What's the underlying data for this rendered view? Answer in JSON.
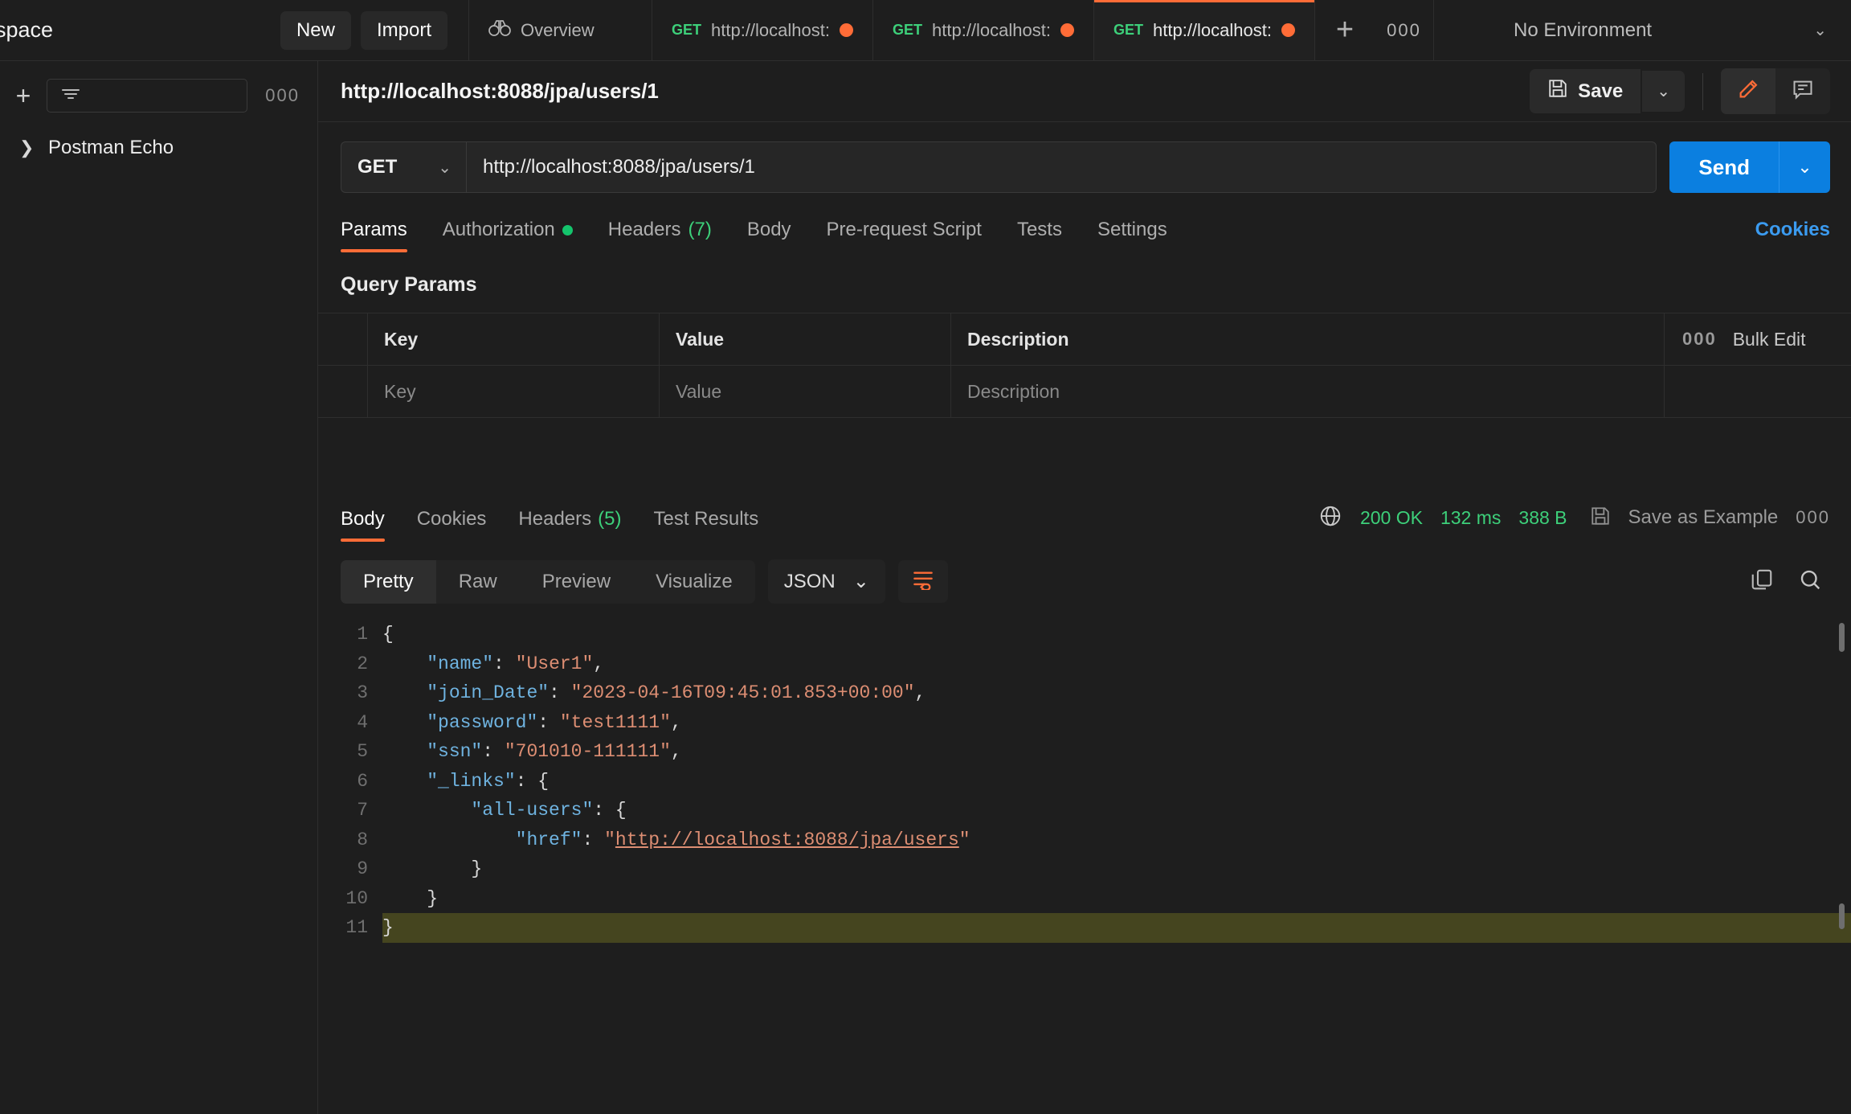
{
  "workspace": {
    "title": "space",
    "new_button": "New",
    "import_button": "Import"
  },
  "tabs": [
    {
      "label": "Overview",
      "icon": "binoculars-icon",
      "method": "",
      "active": false,
      "unsaved": false
    },
    {
      "label": "http://localhost:",
      "method": "GET",
      "active": false,
      "unsaved": true
    },
    {
      "label": "http://localhost:",
      "method": "GET",
      "active": false,
      "unsaved": true
    },
    {
      "label": "http://localhost:",
      "method": "GET",
      "active": true,
      "unsaved": true
    }
  ],
  "tab_actions": {
    "new_tab": "+",
    "more": "000"
  },
  "environment": {
    "selected": "No Environment",
    "caret": "chevron-down-icon"
  },
  "sidebar": {
    "add_icon": "+",
    "filter_icon": "filter-icon",
    "more_icon": "000",
    "items": [
      {
        "label": "Postman Echo",
        "caret": "chevron-right-icon"
      }
    ]
  },
  "request": {
    "title": "http://localhost:8088/jpa/users/1",
    "save_label": "Save",
    "save_icon": "floppy-icon",
    "save_caret": "chevron-down-icon",
    "edit_icon": "pencil-icon",
    "comment_icon": "comment-icon",
    "method": "GET",
    "url": "http://localhost:8088/jpa/users/1",
    "send_label": "Send",
    "send_caret": "chevron-down-icon",
    "tabs": [
      {
        "label": "Params",
        "active": true,
        "badge": ""
      },
      {
        "label": "Authorization",
        "active": false,
        "badge": "dot"
      },
      {
        "label": "Headers",
        "active": false,
        "badge": "(7)"
      },
      {
        "label": "Body",
        "active": false,
        "badge": ""
      },
      {
        "label": "Pre-request Script",
        "active": false,
        "badge": ""
      },
      {
        "label": "Tests",
        "active": false,
        "badge": ""
      },
      {
        "label": "Settings",
        "active": false,
        "badge": ""
      }
    ],
    "cookies_link": "Cookies",
    "query_params_title": "Query Params",
    "table": {
      "headers": [
        "Key",
        "Value",
        "Description"
      ],
      "actions": {
        "more": "000",
        "bulk_edit": "Bulk Edit"
      },
      "rows": [
        {
          "key": "Key",
          "value": "Value",
          "description": "Description",
          "placeholder": true
        }
      ]
    }
  },
  "response": {
    "tabs": [
      {
        "label": "Body",
        "active": true,
        "badge": ""
      },
      {
        "label": "Cookies",
        "active": false,
        "badge": ""
      },
      {
        "label": "Headers",
        "active": false,
        "badge": "(5)"
      },
      {
        "label": "Test Results",
        "active": false,
        "badge": ""
      }
    ],
    "status": {
      "globe_icon": "globe-icon",
      "code": "200 OK",
      "time": "132 ms",
      "size": "388 B",
      "save_example_icon": "floppy-icon",
      "save_example": "Save as Example",
      "more": "000"
    },
    "view_modes": [
      "Pretty",
      "Raw",
      "Preview",
      "Visualize"
    ],
    "active_view": "Pretty",
    "format": "JSON",
    "format_caret": "chevron-down-icon",
    "wrap_icon": "word-wrap-icon",
    "copy_icon": "copy-icon",
    "search_icon": "search-icon",
    "body_lines": [
      {
        "n": "1",
        "tokens": [
          {
            "t": "p",
            "v": "{"
          }
        ]
      },
      {
        "n": "2",
        "tokens": [
          {
            "t": "p",
            "v": "    "
          },
          {
            "t": "k",
            "v": "\"name\""
          },
          {
            "t": "p",
            "v": ": "
          },
          {
            "t": "s",
            "v": "\"User1\""
          },
          {
            "t": "p",
            "v": ","
          }
        ]
      },
      {
        "n": "3",
        "tokens": [
          {
            "t": "p",
            "v": "    "
          },
          {
            "t": "k",
            "v": "\"join_Date\""
          },
          {
            "t": "p",
            "v": ": "
          },
          {
            "t": "s",
            "v": "\"2023-04-16T09:45:01.853+00:00\""
          },
          {
            "t": "p",
            "v": ","
          }
        ]
      },
      {
        "n": "4",
        "tokens": [
          {
            "t": "p",
            "v": "    "
          },
          {
            "t": "k",
            "v": "\"password\""
          },
          {
            "t": "p",
            "v": ": "
          },
          {
            "t": "s",
            "v": "\"test1111\""
          },
          {
            "t": "p",
            "v": ","
          }
        ]
      },
      {
        "n": "5",
        "tokens": [
          {
            "t": "p",
            "v": "    "
          },
          {
            "t": "k",
            "v": "\"ssn\""
          },
          {
            "t": "p",
            "v": ": "
          },
          {
            "t": "s",
            "v": "\"701010-111111\""
          },
          {
            "t": "p",
            "v": ","
          }
        ]
      },
      {
        "n": "6",
        "tokens": [
          {
            "t": "p",
            "v": "    "
          },
          {
            "t": "k",
            "v": "\"_links\""
          },
          {
            "t": "p",
            "v": ": {"
          }
        ]
      },
      {
        "n": "7",
        "tokens": [
          {
            "t": "p",
            "v": "        "
          },
          {
            "t": "k",
            "v": "\"all-users\""
          },
          {
            "t": "p",
            "v": ": {"
          }
        ]
      },
      {
        "n": "8",
        "tokens": [
          {
            "t": "p",
            "v": "            "
          },
          {
            "t": "k",
            "v": "\"href\""
          },
          {
            "t": "p",
            "v": ": "
          },
          {
            "t": "s",
            "v": "\""
          },
          {
            "t": "lnk",
            "v": "http://localhost:8088/jpa/users"
          },
          {
            "t": "s",
            "v": "\""
          }
        ]
      },
      {
        "n": "9",
        "tokens": [
          {
            "t": "p",
            "v": "        }"
          }
        ]
      },
      {
        "n": "10",
        "tokens": [
          {
            "t": "p",
            "v": "    }"
          }
        ]
      },
      {
        "n": "11",
        "tokens": [
          {
            "t": "p",
            "v": "}"
          }
        ],
        "selected": true
      }
    ]
  },
  "colors": {
    "accent": "#ff6c37",
    "success": "#3dd07a",
    "link": "#3b9bf0",
    "send": "#0b7fe0",
    "bg": "#1e1e1e"
  }
}
